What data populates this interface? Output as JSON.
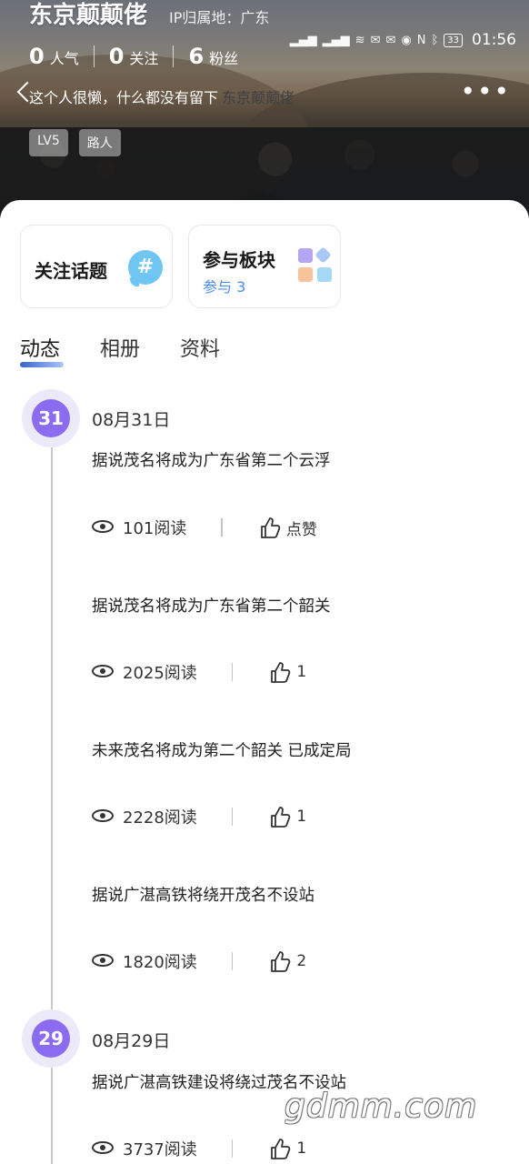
{
  "status_bar": {
    "time": "01:56",
    "battery": "33"
  },
  "profile": {
    "name": "东京颠颠佬",
    "ip_location": "IP归属地：广东",
    "stats": [
      {
        "num": "0",
        "label": "人气"
      },
      {
        "num": "0",
        "label": "关注"
      },
      {
        "num": "6",
        "label": "粉丝"
      }
    ],
    "bio": "这个人很懒，什么都没有留下",
    "nav_title": "东京颠颠佬",
    "more_label": "•••",
    "tags": [
      "LV5",
      "路人"
    ]
  },
  "features": {
    "topic": {
      "title": "关注话题",
      "icon": "#"
    },
    "board": {
      "title": "参与板块",
      "sub": "参与 3"
    }
  },
  "tabs": [
    {
      "label": "动态",
      "active": true
    },
    {
      "label": "相册",
      "active": false
    },
    {
      "label": "资料",
      "active": false
    }
  ],
  "timeline": [
    {
      "day": "31",
      "date": "08月31日",
      "posts": [
        {
          "title": "据说茂名将成为广东省第二个云浮",
          "reads": "101阅读",
          "likes": "点赞"
        },
        {
          "title": "据说茂名将成为广东省第二个韶关",
          "reads": "2025阅读",
          "likes": "1"
        },
        {
          "title": "未来茂名将成为第二个韶关 已成定局",
          "reads": "2228阅读",
          "likes": "1"
        },
        {
          "title": "据说广湛高铁将绕开茂名不设站",
          "reads": "1820阅读",
          "likes": "2"
        }
      ]
    },
    {
      "day": "29",
      "date": "08月29日",
      "posts": [
        {
          "title": "据说广湛高铁建设将绕过茂名不设站",
          "reads": "3737阅读",
          "likes": "1"
        }
      ]
    }
  ],
  "watermark": "gdmm.com",
  "colors": {
    "accent_purple": "#8b6cf0",
    "link_blue": "#4a8df5",
    "topic_icon": "#6fc6f2"
  }
}
